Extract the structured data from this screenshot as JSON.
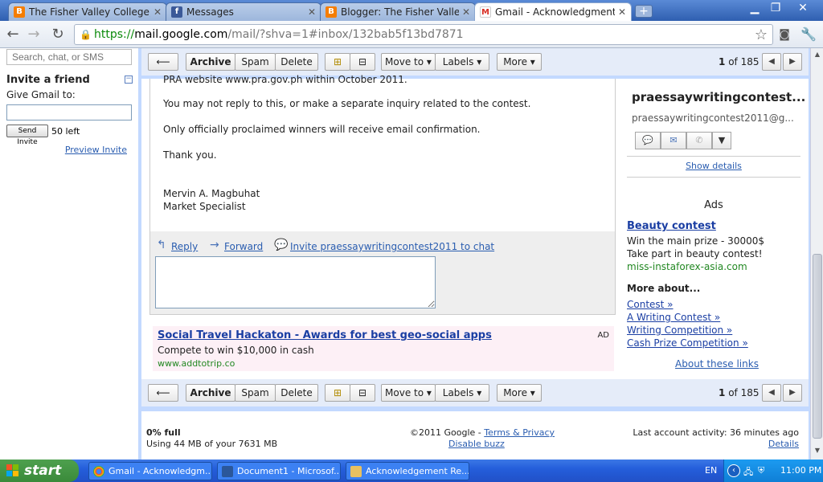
{
  "browser": {
    "tabs": [
      {
        "title": "The Fisher Valley College, Tag",
        "icon": "blogger-icon",
        "color": "#f57d00"
      },
      {
        "title": "Messages",
        "icon": "facebook-icon",
        "color": "#3b5998"
      },
      {
        "title": "Blogger: The Fisher Valley Colle",
        "icon": "blogger-icon",
        "color": "#f57d00"
      },
      {
        "title": "Gmail - Acknowledgment of Re",
        "icon": "gmail-icon",
        "color": "#d93025",
        "active": true
      }
    ],
    "url_scheme": "https://",
    "url_host": "mail.google.com",
    "url_path": "/mail/?shva=1#inbox/132bab5f13bd7871"
  },
  "sidebar": {
    "search_placeholder": "Search, chat, or SMS",
    "invite_title": "Invite a friend",
    "give_label": "Give Gmail to:",
    "send_invite": "Send Invite",
    "left_count": "50 left",
    "preview_invite": "Preview Invite"
  },
  "actions": {
    "archive": "Archive",
    "spam": "Spam",
    "delete": "Delete",
    "move_to": "Move to ▾",
    "labels": "Labels ▾",
    "more": "More ▾",
    "page_current": "1",
    "page_of": "of 185"
  },
  "message": {
    "lines": [
      "PRA website www.pra.gov.ph within October 2011.",
      "You may not reply to this, or make a separate inquiry related to the contest.",
      "Only officially proclaimed winners will receive email confirmation.",
      "Thank you.",
      "Mervin A. Magbuhat",
      "Market Specialist"
    ],
    "reply": "Reply",
    "forward": "Forward",
    "invite_chat": "Invite praessaywritingcontest2011 to chat"
  },
  "ad_banner": {
    "title": "Social Travel Hackaton - Awards for best geo-social apps",
    "desc": "Compete to win $10,000 in cash",
    "url": "www.addtotrip.co",
    "tag": "AD"
  },
  "contact": {
    "name": "praessaywritingcontest...",
    "email": "praessaywritingcontest2011@g...",
    "show_details": "Show details"
  },
  "ads": {
    "heading": "Ads",
    "title": "Beauty contest",
    "line1": "Win the main prize - 30000$",
    "line2": "Take part in beauty contest!",
    "url": "miss-instaforex-asia.com",
    "more_about": "More about...",
    "links": [
      "Contest »",
      "A Writing Contest »",
      "Writing Competition »",
      "Cash Prize Competition »"
    ],
    "about": "About these links"
  },
  "footer": {
    "usage_pct": "0% full",
    "usage_detail": "Using 44 MB of your 7631 MB",
    "copyright": "©2011 Google - ",
    "terms": "Terms & Privacy",
    "disable_buzz": "Disable buzz",
    "last_activity": "Last account activity: 36 minutes ago",
    "details": "Details"
  },
  "taskbar": {
    "start": "start",
    "items": [
      {
        "label": "Gmail - Acknowledgm...",
        "icon": "chrome-icon"
      },
      {
        "label": "Document1 - Microsof...",
        "icon": "word-icon"
      },
      {
        "label": "Acknowledgement Re...",
        "icon": "paint-icon"
      }
    ],
    "lang": "EN",
    "clock": "11:00 PM"
  }
}
